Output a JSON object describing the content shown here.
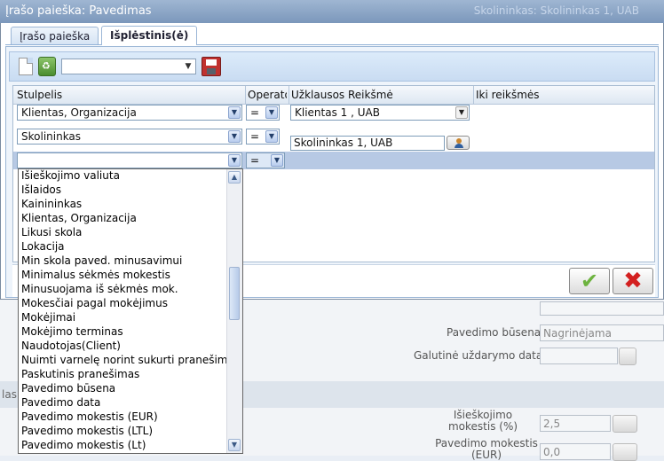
{
  "window": {
    "title": "Įrašo paieška: Pavedimas",
    "ghost_left": "Klientas 1 , UAB",
    "ghost_right": "Skolininkas: Skolininkas 1, UAB"
  },
  "tabs": [
    {
      "label": "Įrašo paieška",
      "active": false
    },
    {
      "label": "Išplėstinis(ė)",
      "active": true
    }
  ],
  "toolbar": {
    "template_value": "",
    "icons": [
      "new-document-icon",
      "recycle-icon",
      "save-disk-icon"
    ]
  },
  "grid": {
    "columns": [
      "Stulpelis",
      "Operator",
      "Užklausos Reikšmė",
      "Iki reikšmės"
    ],
    "rows": [
      {
        "column": "Klientas, Organizacija",
        "operator": "=",
        "value": "Klientas 1 , UAB",
        "to": ""
      },
      {
        "column": "Skolininkas",
        "operator": "=",
        "value": "Skolininkas 1, UAB",
        "to": ""
      },
      {
        "column": "",
        "operator": "=",
        "value": "",
        "to": ""
      }
    ]
  },
  "dropdown": {
    "items": [
      "Išieškojimo valiuta",
      "Išlaidos",
      "Kainininkas",
      "Klientas, Organizacija",
      "Likusi skola",
      "Lokacija",
      "Min skola paved. minusavimui",
      "Minimalus sėkmės mokestis",
      "Minusuojama iš sėkmės mok.",
      "Mokesčiai pagal mokėjimus",
      "Mokėjimai",
      "Mokėjimo terminas",
      "Naudotojas(Client)",
      "Nuimti varnelę norint sukurti pranešimą",
      "Paskutinis pranešimas",
      "Pavedimo būsena",
      "Pavedimo data",
      "Pavedimo mokestis (EUR)",
      "Pavedimo mokestis (LTL)",
      "Pavedimo mokestis (Lt)"
    ]
  },
  "background": {
    "status_label": "Pavedimo būsena",
    "status_value": "Nagrinėjama",
    "closing_label": "Galutinė uždarymo data",
    "recovery_label": "Išieškojimo mokestis (%)",
    "recovery_value": "2,5",
    "fee_label": "Pavedimo mokestis (EUR)",
    "fee_value": "0,0",
    "section_fragment": "las"
  }
}
